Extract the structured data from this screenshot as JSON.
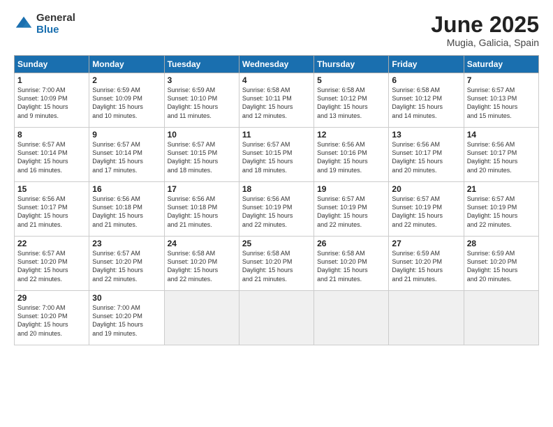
{
  "logo": {
    "general": "General",
    "blue": "Blue"
  },
  "title": "June 2025",
  "subtitle": "Mugia, Galicia, Spain",
  "headers": [
    "Sunday",
    "Monday",
    "Tuesday",
    "Wednesday",
    "Thursday",
    "Friday",
    "Saturday"
  ],
  "weeks": [
    [
      {
        "day": "1",
        "info": "Sunrise: 7:00 AM\nSunset: 10:09 PM\nDaylight: 15 hours\nand 9 minutes."
      },
      {
        "day": "2",
        "info": "Sunrise: 6:59 AM\nSunset: 10:09 PM\nDaylight: 15 hours\nand 10 minutes."
      },
      {
        "day": "3",
        "info": "Sunrise: 6:59 AM\nSunset: 10:10 PM\nDaylight: 15 hours\nand 11 minutes."
      },
      {
        "day": "4",
        "info": "Sunrise: 6:58 AM\nSunset: 10:11 PM\nDaylight: 15 hours\nand 12 minutes."
      },
      {
        "day": "5",
        "info": "Sunrise: 6:58 AM\nSunset: 10:12 PM\nDaylight: 15 hours\nand 13 minutes."
      },
      {
        "day": "6",
        "info": "Sunrise: 6:58 AM\nSunset: 10:12 PM\nDaylight: 15 hours\nand 14 minutes."
      },
      {
        "day": "7",
        "info": "Sunrise: 6:57 AM\nSunset: 10:13 PM\nDaylight: 15 hours\nand 15 minutes."
      }
    ],
    [
      {
        "day": "8",
        "info": "Sunrise: 6:57 AM\nSunset: 10:14 PM\nDaylight: 15 hours\nand 16 minutes."
      },
      {
        "day": "9",
        "info": "Sunrise: 6:57 AM\nSunset: 10:14 PM\nDaylight: 15 hours\nand 17 minutes."
      },
      {
        "day": "10",
        "info": "Sunrise: 6:57 AM\nSunset: 10:15 PM\nDaylight: 15 hours\nand 18 minutes."
      },
      {
        "day": "11",
        "info": "Sunrise: 6:57 AM\nSunset: 10:15 PM\nDaylight: 15 hours\nand 18 minutes."
      },
      {
        "day": "12",
        "info": "Sunrise: 6:56 AM\nSunset: 10:16 PM\nDaylight: 15 hours\nand 19 minutes."
      },
      {
        "day": "13",
        "info": "Sunrise: 6:56 AM\nSunset: 10:17 PM\nDaylight: 15 hours\nand 20 minutes."
      },
      {
        "day": "14",
        "info": "Sunrise: 6:56 AM\nSunset: 10:17 PM\nDaylight: 15 hours\nand 20 minutes."
      }
    ],
    [
      {
        "day": "15",
        "info": "Sunrise: 6:56 AM\nSunset: 10:17 PM\nDaylight: 15 hours\nand 21 minutes."
      },
      {
        "day": "16",
        "info": "Sunrise: 6:56 AM\nSunset: 10:18 PM\nDaylight: 15 hours\nand 21 minutes."
      },
      {
        "day": "17",
        "info": "Sunrise: 6:56 AM\nSunset: 10:18 PM\nDaylight: 15 hours\nand 21 minutes."
      },
      {
        "day": "18",
        "info": "Sunrise: 6:56 AM\nSunset: 10:19 PM\nDaylight: 15 hours\nand 22 minutes."
      },
      {
        "day": "19",
        "info": "Sunrise: 6:57 AM\nSunset: 10:19 PM\nDaylight: 15 hours\nand 22 minutes."
      },
      {
        "day": "20",
        "info": "Sunrise: 6:57 AM\nSunset: 10:19 PM\nDaylight: 15 hours\nand 22 minutes."
      },
      {
        "day": "21",
        "info": "Sunrise: 6:57 AM\nSunset: 10:19 PM\nDaylight: 15 hours\nand 22 minutes."
      }
    ],
    [
      {
        "day": "22",
        "info": "Sunrise: 6:57 AM\nSunset: 10:20 PM\nDaylight: 15 hours\nand 22 minutes."
      },
      {
        "day": "23",
        "info": "Sunrise: 6:57 AM\nSunset: 10:20 PM\nDaylight: 15 hours\nand 22 minutes."
      },
      {
        "day": "24",
        "info": "Sunrise: 6:58 AM\nSunset: 10:20 PM\nDaylight: 15 hours\nand 22 minutes."
      },
      {
        "day": "25",
        "info": "Sunrise: 6:58 AM\nSunset: 10:20 PM\nDaylight: 15 hours\nand 21 minutes."
      },
      {
        "day": "26",
        "info": "Sunrise: 6:58 AM\nSunset: 10:20 PM\nDaylight: 15 hours\nand 21 minutes."
      },
      {
        "day": "27",
        "info": "Sunrise: 6:59 AM\nSunset: 10:20 PM\nDaylight: 15 hours\nand 21 minutes."
      },
      {
        "day": "28",
        "info": "Sunrise: 6:59 AM\nSunset: 10:20 PM\nDaylight: 15 hours\nand 20 minutes."
      }
    ],
    [
      {
        "day": "29",
        "info": "Sunrise: 7:00 AM\nSunset: 10:20 PM\nDaylight: 15 hours\nand 20 minutes."
      },
      {
        "day": "30",
        "info": "Sunrise: 7:00 AM\nSunset: 10:20 PM\nDaylight: 15 hours\nand 19 minutes."
      },
      {
        "day": "",
        "info": ""
      },
      {
        "day": "",
        "info": ""
      },
      {
        "day": "",
        "info": ""
      },
      {
        "day": "",
        "info": ""
      },
      {
        "day": "",
        "info": ""
      }
    ]
  ]
}
